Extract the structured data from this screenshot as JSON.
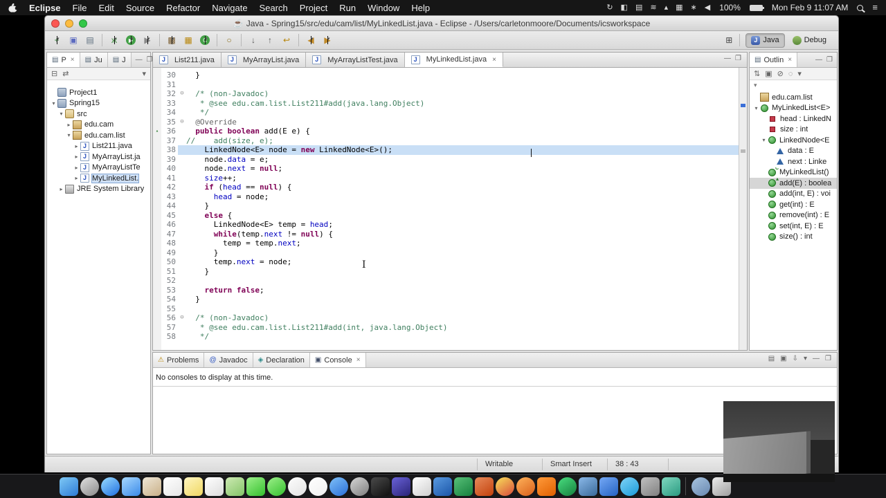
{
  "menubar": {
    "app_name": "Eclipse",
    "menus": [
      "File",
      "Edit",
      "Source",
      "Refactor",
      "Navigate",
      "Search",
      "Project",
      "Run",
      "Window",
      "Help"
    ],
    "status_icons": [
      {
        "name": "sync-icon",
        "glyph": "↻"
      },
      {
        "name": "screen-mirroring-icon",
        "glyph": "◧"
      },
      {
        "name": "display-icon",
        "glyph": "▤"
      },
      {
        "name": "wifi-icon",
        "glyph": "≋"
      },
      {
        "name": "eject-icon",
        "glyph": "▴"
      },
      {
        "name": "keyboard-icon",
        "glyph": "▦"
      },
      {
        "name": "bluetooth-icon",
        "glyph": "∗"
      },
      {
        "name": "volume-icon",
        "glyph": "◀"
      }
    ],
    "battery_percent": "100%",
    "clock": "Mon Feb 9 11:07 AM"
  },
  "window": {
    "title": "Java - Spring15/src/edu/cam/list/MyLinkedList.java - Eclipse - /Users/carletonmoore/Documents/icsworkspace",
    "title_icon": "☕"
  },
  "toolbar": {
    "buttons": [
      {
        "name": "new",
        "glyph": "+",
        "color": "#2e7d32",
        "caret": true
      },
      {
        "name": "save",
        "glyph": "▣",
        "color": "#5c6bc0"
      },
      {
        "name": "print",
        "glyph": "▤",
        "color": "#607080"
      },
      {
        "sep": true
      },
      {
        "name": "debug",
        "glyph": "ж",
        "color": "#3f8f3f",
        "caret": true
      },
      {
        "name": "run",
        "glyph": "▶",
        "round": "#43a047",
        "caret": true
      },
      {
        "name": "external-tools",
        "glyph": "▶",
        "color": "#8a8a8a",
        "caret": true
      },
      {
        "sep": true
      },
      {
        "name": "new-java-project",
        "glyph": "▩",
        "color": "#7a5c2e",
        "caret": true
      },
      {
        "name": "new-package",
        "glyph": "▦",
        "color": "#b8860b"
      },
      {
        "name": "new-class",
        "glyph": "C",
        "round": "#43a047",
        "caret": true
      },
      {
        "sep": true
      },
      {
        "name": "search",
        "glyph": "○",
        "color": "#8a6d1a"
      },
      {
        "sep": true
      },
      {
        "name": "next-annotation",
        "glyph": "↓",
        "color": "#555555"
      },
      {
        "name": "prev-annotation",
        "glyph": "↑",
        "color": "#555555"
      },
      {
        "name": "last-edit-location",
        "glyph": "↩",
        "color": "#b8860b"
      },
      {
        "sep": true
      },
      {
        "name": "back",
        "glyph": "◀",
        "color": "#c08a2a",
        "caret": true
      },
      {
        "name": "forward",
        "glyph": "▶",
        "color": "#c08a2a",
        "caret": true
      }
    ],
    "open_perspective_glyph": "⊞",
    "perspectives": [
      {
        "label": "Java",
        "icon": "java",
        "active": true
      },
      {
        "label": "Debug",
        "icon": "bug",
        "active": false
      }
    ]
  },
  "package_explorer": {
    "tabs": [
      {
        "label": "P",
        "active": true,
        "close": "×"
      },
      {
        "label": "Ju",
        "active": false
      },
      {
        "label": "J",
        "active": false
      }
    ],
    "tools": [
      "⊟",
      "⇄"
    ],
    "view_menu": "▾",
    "minimize": "—",
    "maximize": "❐",
    "tree": [
      {
        "d": 0,
        "ex": "",
        "ic": "prj",
        "t": "Project1"
      },
      {
        "d": 0,
        "ex": "v",
        "ic": "prj",
        "t": "Spring15"
      },
      {
        "d": 1,
        "ex": "v",
        "ic": "src",
        "t": "src"
      },
      {
        "d": 2,
        "ex": ">",
        "ic": "pkg",
        "t": "edu.cam"
      },
      {
        "d": 2,
        "ex": "v",
        "ic": "pkg",
        "t": "edu.cam.list"
      },
      {
        "d": 3,
        "ex": ">",
        "ic": "jfile",
        "t": "List211.java"
      },
      {
        "d": 3,
        "ex": ">",
        "ic": "jfile",
        "t": "MyArrayList.ja"
      },
      {
        "d": 3,
        "ex": ">",
        "ic": "jfile",
        "t": "MyArrayListTe"
      },
      {
        "d": 3,
        "ex": ">",
        "ic": "jfile",
        "t": "MyLinkedList.",
        "sel": true
      },
      {
        "d": 1,
        "ex": ">",
        "ic": "lib",
        "t": "JRE System Library"
      }
    ]
  },
  "editor": {
    "tabs": [
      {
        "label": "List211.java",
        "active": false
      },
      {
        "label": "MyArrayList.java",
        "active": false
      },
      {
        "label": "MyArrayListTest.java",
        "active": false
      },
      {
        "label": "MyLinkedList.java",
        "active": true,
        "close": "×"
      }
    ],
    "minimize": "—",
    "maximize": "❐",
    "cursor_line": 38,
    "cursor_col": 43,
    "lines": [
      {
        "n": 30,
        "seg": [
          [
            "pl",
            "  }"
          ]
        ]
      },
      {
        "n": 31,
        "seg": []
      },
      {
        "n": 32,
        "fold": true,
        "seg": [
          [
            "cm",
            "  /* (non-Javadoc)"
          ]
        ]
      },
      {
        "n": 33,
        "seg": [
          [
            "cm",
            "   * @see edu.cam.list.List211#add(java.lang.Object)"
          ]
        ]
      },
      {
        "n": 34,
        "seg": [
          [
            "cm",
            "   */"
          ]
        ]
      },
      {
        "n": 35,
        "fold": true,
        "seg": [
          [
            "ann",
            "  @Override"
          ]
        ]
      },
      {
        "n": 36,
        "marker": "▴",
        "seg": [
          [
            "kw",
            "  public boolean "
          ],
          [
            "pl",
            "add(E e) {"
          ]
        ]
      },
      {
        "n": 37,
        "seg": [
          [
            "cm",
            "//    add(size, e);"
          ]
        ]
      },
      {
        "n": 38,
        "hl": true,
        "seg": [
          [
            "pl",
            "    LinkedNode<E> node = "
          ],
          [
            "kw",
            "new"
          ],
          [
            "pl",
            " LinkedNode<E>();"
          ]
        ]
      },
      {
        "n": 39,
        "seg": [
          [
            "pl",
            "    node."
          ],
          [
            "fld",
            "data"
          ],
          [
            "pl",
            " = e;"
          ]
        ]
      },
      {
        "n": 40,
        "seg": [
          [
            "pl",
            "    node."
          ],
          [
            "fld",
            "next"
          ],
          [
            "pl",
            " = "
          ],
          [
            "kw",
            "null"
          ],
          [
            "pl",
            ";"
          ]
        ]
      },
      {
        "n": 41,
        "seg": [
          [
            "pl",
            "    "
          ],
          [
            "fld",
            "size"
          ],
          [
            "pl",
            "++;"
          ]
        ]
      },
      {
        "n": 42,
        "seg": [
          [
            "pl",
            "    "
          ],
          [
            "kw",
            "if"
          ],
          [
            "pl",
            " ("
          ],
          [
            "fld",
            "head"
          ],
          [
            "pl",
            " == "
          ],
          [
            "kw",
            "null"
          ],
          [
            "pl",
            ") {"
          ]
        ]
      },
      {
        "n": 43,
        "seg": [
          [
            "pl",
            "      "
          ],
          [
            "fld",
            "head"
          ],
          [
            "pl",
            " = node;"
          ]
        ]
      },
      {
        "n": 44,
        "seg": [
          [
            "pl",
            "    }"
          ]
        ]
      },
      {
        "n": 45,
        "seg": [
          [
            "pl",
            "    "
          ],
          [
            "kw",
            "else"
          ],
          [
            "pl",
            " {"
          ]
        ]
      },
      {
        "n": 46,
        "seg": [
          [
            "pl",
            "      LinkedNode<E> temp = "
          ],
          [
            "fld",
            "head"
          ],
          [
            "pl",
            ";"
          ]
        ]
      },
      {
        "n": 47,
        "seg": [
          [
            "pl",
            "      "
          ],
          [
            "kw",
            "while"
          ],
          [
            "pl",
            "(temp."
          ],
          [
            "fld",
            "next"
          ],
          [
            "pl",
            " != "
          ],
          [
            "kw",
            "null"
          ],
          [
            "pl",
            ") {"
          ]
        ]
      },
      {
        "n": 48,
        "seg": [
          [
            "pl",
            "        temp = temp."
          ],
          [
            "fld",
            "next"
          ],
          [
            "pl",
            ";"
          ]
        ]
      },
      {
        "n": 49,
        "seg": [
          [
            "pl",
            "      }"
          ]
        ]
      },
      {
        "n": 50,
        "seg": [
          [
            "pl",
            "      temp."
          ],
          [
            "fld",
            "next"
          ],
          [
            "pl",
            " = node;"
          ]
        ]
      },
      {
        "n": 51,
        "seg": [
          [
            "pl",
            "    }"
          ]
        ]
      },
      {
        "n": 52,
        "seg": []
      },
      {
        "n": 53,
        "seg": [
          [
            "pl",
            "    "
          ],
          [
            "kw",
            "return false"
          ],
          [
            "pl",
            ";"
          ]
        ]
      },
      {
        "n": 54,
        "seg": [
          [
            "pl",
            "  }"
          ]
        ]
      },
      {
        "n": 55,
        "seg": []
      },
      {
        "n": 56,
        "fold": true,
        "seg": [
          [
            "cm",
            "  /* (non-Javadoc)"
          ]
        ]
      },
      {
        "n": 57,
        "seg": [
          [
            "cm",
            "   * @see edu.cam.list.List211#add(int, java.lang.Object)"
          ]
        ]
      },
      {
        "n": 58,
        "seg": [
          [
            "cm",
            "   */"
          ]
        ]
      }
    ]
  },
  "outline": {
    "tab": {
      "label": "Outlin",
      "close": "×"
    },
    "tools": [
      "⇅",
      "▣",
      "⊘",
      "◌",
      "▾"
    ],
    "view_menu": "▾",
    "minimize": "—",
    "maximize": "❐",
    "tree": [
      {
        "d": 0,
        "ex": "",
        "ic": "pkgo",
        "t": "edu.cam.list"
      },
      {
        "d": 0,
        "ex": "v",
        "ic": "class",
        "t": "MyLinkedList<E>"
      },
      {
        "d": 1,
        "ex": "",
        "ic": "fpri",
        "t": "head : LinkedN"
      },
      {
        "d": 1,
        "ex": "",
        "ic": "fpri",
        "t": "size : int"
      },
      {
        "d": 1,
        "ex": "v",
        "ic": "class",
        "t": "LinkedNode<E"
      },
      {
        "d": 2,
        "ex": "",
        "ic": "fpkg",
        "t": "data : E"
      },
      {
        "d": 2,
        "ex": "",
        "ic": "fpkg",
        "t": "next : Linke"
      },
      {
        "d": 1,
        "ex": "",
        "ic": "cons",
        "t": "MyLinkedList()"
      },
      {
        "d": 1,
        "ex": "",
        "ic": "mover",
        "t": "add(E) : boolea",
        "sel": true
      },
      {
        "d": 1,
        "ex": "",
        "ic": "meth",
        "t": "add(int, E) : voi"
      },
      {
        "d": 1,
        "ex": "",
        "ic": "meth",
        "t": "get(int) : E"
      },
      {
        "d": 1,
        "ex": "",
        "ic": "meth",
        "t": "remove(int) : E"
      },
      {
        "d": 1,
        "ex": "",
        "ic": "meth",
        "t": "set(int, E) : E"
      },
      {
        "d": 1,
        "ex": "",
        "ic": "meth",
        "t": "size() : int"
      }
    ]
  },
  "console": {
    "tabs": [
      {
        "label": "Problems",
        "glyph": "⚠",
        "gcolor": "#b8860b",
        "active": false
      },
      {
        "label": "Javadoc",
        "glyph": "@",
        "gcolor": "#2a52be",
        "active": false
      },
      {
        "label": "Declaration",
        "glyph": "◈",
        "gcolor": "#2e8b8b",
        "active": false
      },
      {
        "label": "Console",
        "glyph": "▣",
        "gcolor": "#44506a",
        "active": true,
        "close": "×"
      }
    ],
    "tools": [
      "▤",
      "▣",
      "⇩",
      "▾"
    ],
    "minimize": "—",
    "maximize": "❐",
    "message": "No consoles to display at this time."
  },
  "statusbar": {
    "writable": "Writable",
    "smart_insert": "Smart Insert",
    "position": "38 : 43"
  },
  "dock": {
    "icons": [
      {
        "name": "finder",
        "c": [
          "#7ec8f5",
          "#2e7cd6"
        ]
      },
      {
        "name": "launchpad",
        "c": [
          "#e0e0e0",
          "#8a8a8a"
        ],
        "round": true
      },
      {
        "name": "safari",
        "c": [
          "#9adcff",
          "#1f6fe0"
        ],
        "round": true
      },
      {
        "name": "mail",
        "c": [
          "#a8d8ff",
          "#3a8ae8"
        ]
      },
      {
        "name": "contacts",
        "c": [
          "#efe7d7",
          "#c9b088"
        ]
      },
      {
        "name": "calendar",
        "c": [
          "#ffffff",
          "#e6e6e6"
        ]
      },
      {
        "name": "notes",
        "c": [
          "#fff6c0",
          "#efd763"
        ]
      },
      {
        "name": "reminders",
        "c": [
          "#ffffff",
          "#dcdcdc"
        ]
      },
      {
        "name": "maps",
        "c": [
          "#cdeab2",
          "#84c468"
        ]
      },
      {
        "name": "messages",
        "c": [
          "#9df08a",
          "#35c02e"
        ]
      },
      {
        "name": "facetime",
        "c": [
          "#9df08a",
          "#35c02e"
        ],
        "round": true
      },
      {
        "name": "photos",
        "c": [
          "#fdfdfd",
          "#e2e2e2"
        ],
        "round": true
      },
      {
        "name": "itunes",
        "c": [
          "#ffffff",
          "#f0f0f0"
        ],
        "round": true
      },
      {
        "name": "app-store",
        "c": [
          "#7fc0f8",
          "#2a6fd8"
        ],
        "round": true
      },
      {
        "name": "system-preferences",
        "c": [
          "#d6d6d6",
          "#7e7e7e"
        ],
        "round": true
      },
      {
        "name": "terminal",
        "c": [
          "#4a4a4a",
          "#101010"
        ]
      },
      {
        "name": "eclipse",
        "c": [
          "#6a62d8",
          "#2a2478"
        ]
      },
      {
        "name": "textedit",
        "c": [
          "#ffffff",
          "#cfcfcf"
        ]
      },
      {
        "name": "word",
        "c": [
          "#5a9ae0",
          "#1a55a8"
        ]
      },
      {
        "name": "excel",
        "c": [
          "#58c078",
          "#15803d"
        ]
      },
      {
        "name": "powerpoint",
        "c": [
          "#e88a5a",
          "#c2410c"
        ]
      },
      {
        "name": "chrome",
        "c": [
          "#f8e05a",
          "#d84a3a"
        ],
        "round": true
      },
      {
        "name": "firefox",
        "c": [
          "#ffb25a",
          "#d85f1a"
        ],
        "round": true
      },
      {
        "name": "vlc",
        "c": [
          "#ff9a3a",
          "#e06000"
        ]
      },
      {
        "name": "spotify",
        "c": [
          "#4ade80",
          "#15803d"
        ],
        "round": true
      },
      {
        "name": "xcode",
        "c": [
          "#8ab8e8",
          "#3a6a9a"
        ]
      },
      {
        "name": "dropbox",
        "c": [
          "#74a8f5",
          "#2563c4"
        ]
      },
      {
        "name": "skype",
        "c": [
          "#7fd4f8",
          "#1a9ad8"
        ],
        "round": true
      },
      {
        "name": "vm",
        "c": [
          "#c0c0c0",
          "#808080"
        ]
      },
      {
        "name": "android-studio",
        "c": [
          "#80d8c0",
          "#2a9a80"
        ]
      },
      {
        "sep": true
      },
      {
        "name": "downloads-folder",
        "c": [
          "#a8c4e0",
          "#6888b0"
        ],
        "round": true
      },
      {
        "name": "trash",
        "c": [
          "#ececec",
          "#9e9e9e"
        ]
      }
    ]
  }
}
